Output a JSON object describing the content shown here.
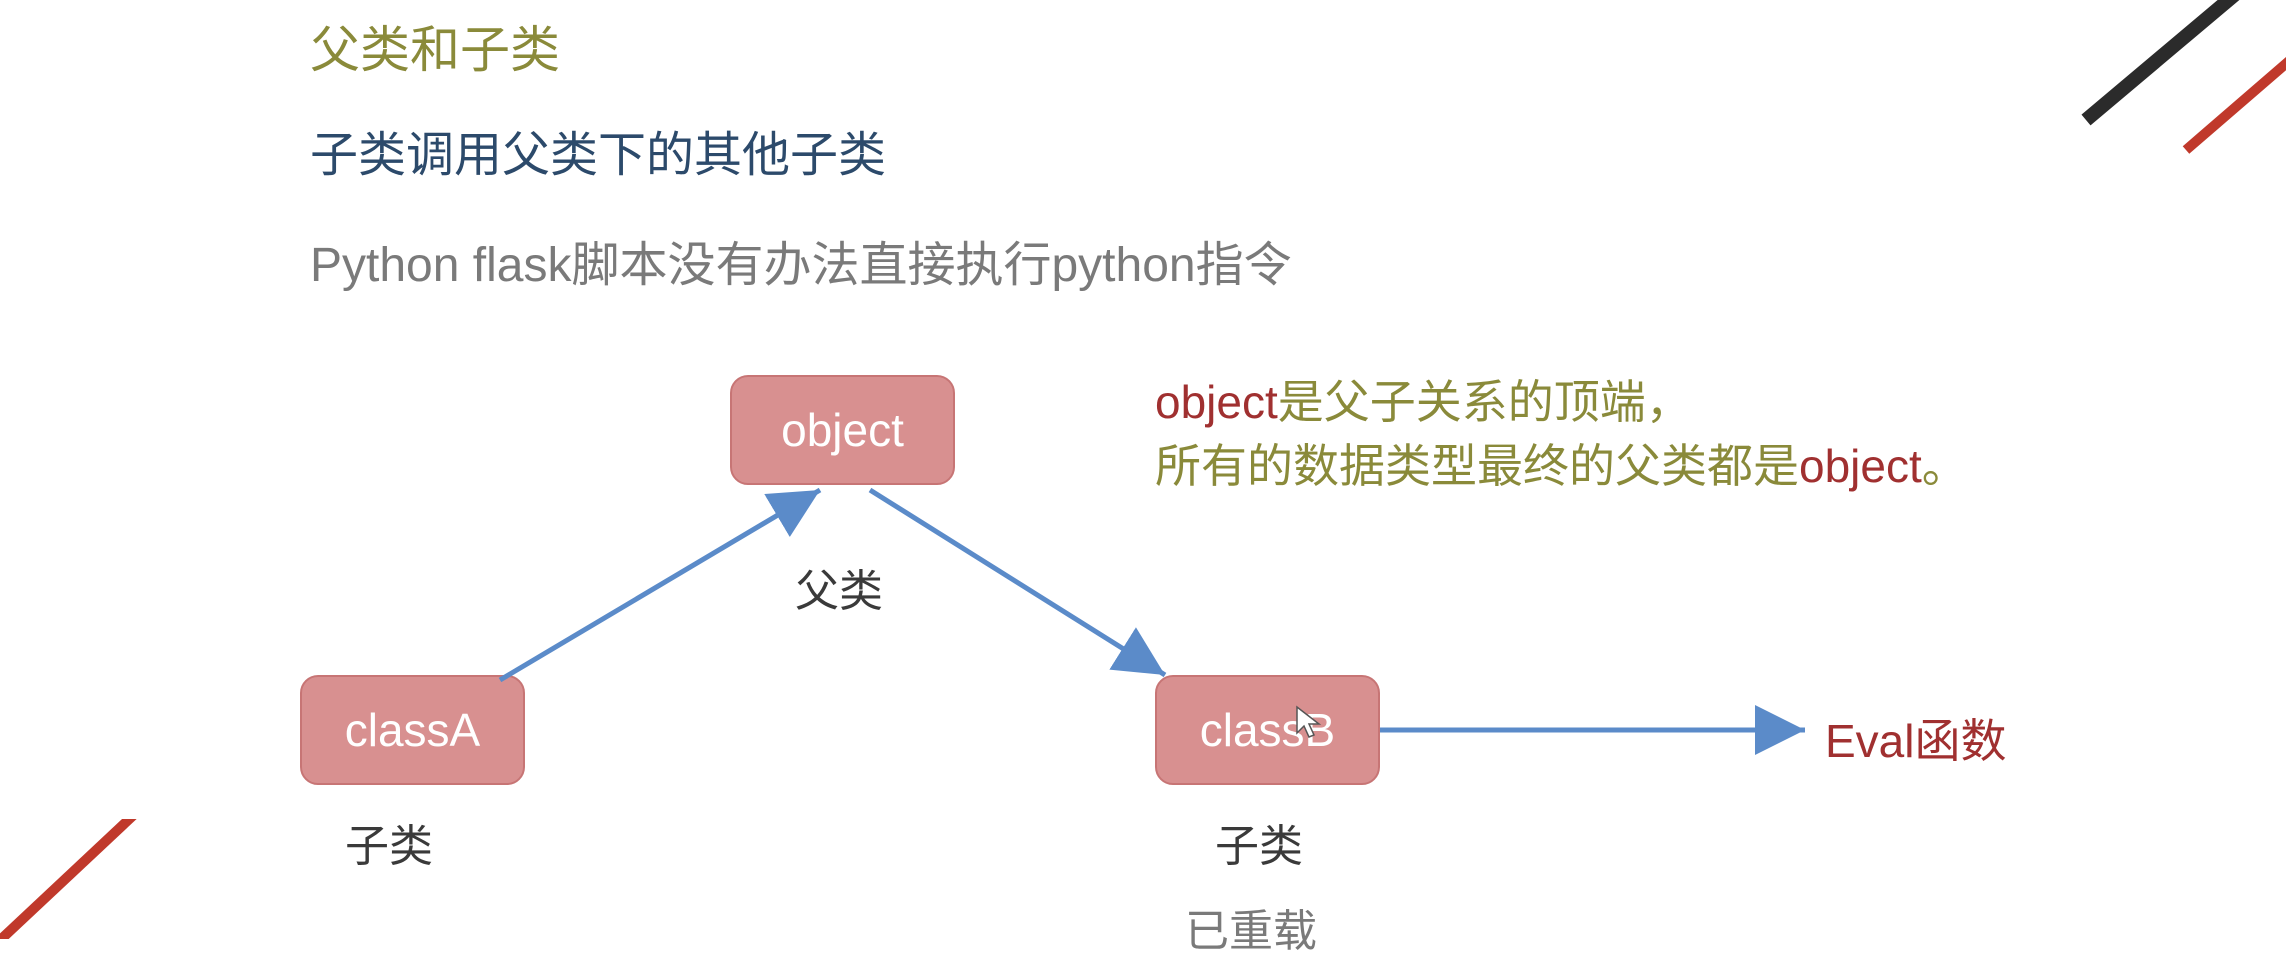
{
  "titles": {
    "main": "父类和子类",
    "sub": "子类调用父类下的其他子类",
    "desc": "Python flask脚本没有办法直接执行python指令"
  },
  "boxes": {
    "object": "object",
    "classA": "classA",
    "classB": "classB"
  },
  "labels": {
    "parent": "父类",
    "childA": "子类",
    "childB": "子类",
    "overloaded": "已重载",
    "eval": "Eval函数"
  },
  "note": {
    "word_object": "object",
    "line1_rest": "是父子关系的顶端，",
    "line2_prefix": "所有的数据类型最终的父类都是",
    "line2_object": "object",
    "line2_suffix": "。"
  },
  "colors": {
    "box_fill": "#d89090",
    "box_border": "#c77575",
    "arrow": "#5b8bc9",
    "olive": "#8a8a3a",
    "darkred": "#a03030",
    "navy": "#2c4a6b",
    "gray": "#7a7a7a"
  }
}
